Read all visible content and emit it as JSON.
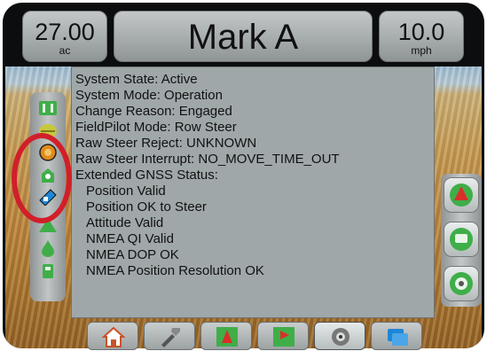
{
  "header": {
    "area_value": "27.00",
    "area_unit": "ac",
    "title": "Mark A",
    "speed_value": "10.0",
    "speed_unit": "mph"
  },
  "status_panel": {
    "lines": [
      "System State: Active",
      "System Mode: Operation",
      "Change Reason: Engaged",
      "FieldPilot Mode: Row Steer",
      "Raw Steer Reject: UNKNOWN",
      "Raw Steer Interrupt: NO_MOVE_TIME_OUT",
      "Extended GNSS Status:",
      "  Position Valid",
      "  Position OK to Steer",
      "  Attitude Valid",
      "  NMEA QI Valid",
      "  NMEA DOP OK",
      "  NMEA Position Resolution OK"
    ]
  },
  "left_status_icons": [
    "boom-sections-icon",
    "gnss-status-icon",
    "steering-status-icon",
    "satellite-icon",
    "tilt-module-icon",
    "guidance-arrow-icon",
    "flow-drop-icon",
    "vehicle-icon"
  ],
  "right_buttons": [
    "guidance-mode-icon",
    "marking-icon",
    "camera-view-icon"
  ],
  "bottom_nav": [
    "home-icon",
    "tools-icon",
    "guidance-icon",
    "field-marking-icon",
    "camera-icon",
    "data-icon"
  ],
  "colors": {
    "highlight_circle": "#d11f2a",
    "accent_green": "#3fae49",
    "accent_blue": "#1e86d6",
    "accent_red": "#d9302a"
  }
}
